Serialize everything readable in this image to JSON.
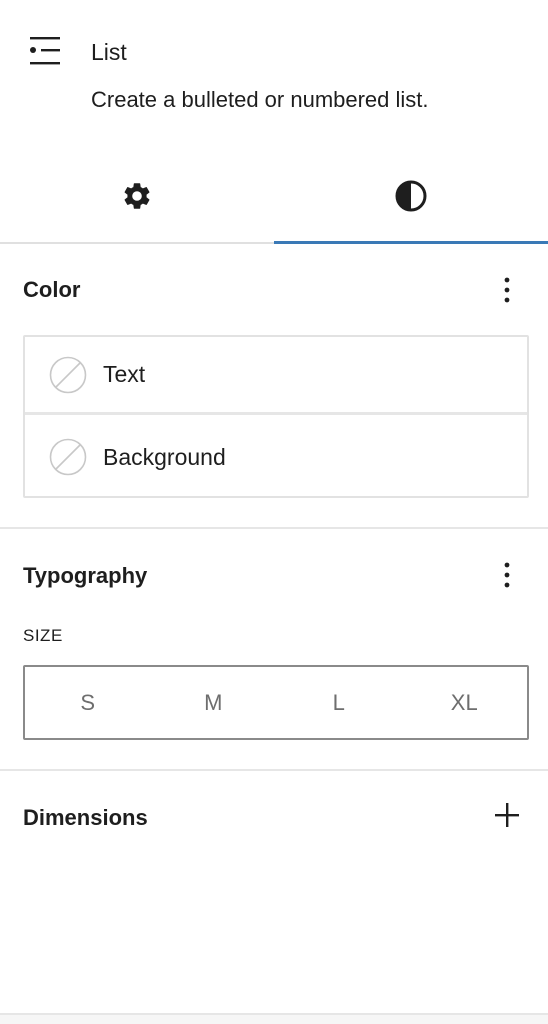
{
  "block": {
    "icon": "list-icon",
    "title": "List",
    "description": "Create a bulleted or numbered list."
  },
  "tabs": [
    {
      "icon": "gear-icon",
      "name": "Settings",
      "active": false
    },
    {
      "icon": "contrast-icon",
      "name": "Styles",
      "active": true
    }
  ],
  "color": {
    "title": "Color",
    "options_icon": "more-vertical-icon",
    "items": [
      {
        "label": "Text",
        "swatch_icon": "no-color-swatch-icon"
      },
      {
        "label": "Background",
        "swatch_icon": "no-color-swatch-icon"
      }
    ]
  },
  "typography": {
    "title": "Typography",
    "options_icon": "more-vertical-icon",
    "size_label": "SIZE",
    "sizes": [
      "S",
      "M",
      "L",
      "XL"
    ]
  },
  "dimensions": {
    "title": "Dimensions",
    "add_icon": "plus-icon"
  },
  "colors": {
    "accent": "#3a79b6",
    "text": "#1e1e1e",
    "muted": "#6e6e6e",
    "border": "#e2e2e2"
  }
}
